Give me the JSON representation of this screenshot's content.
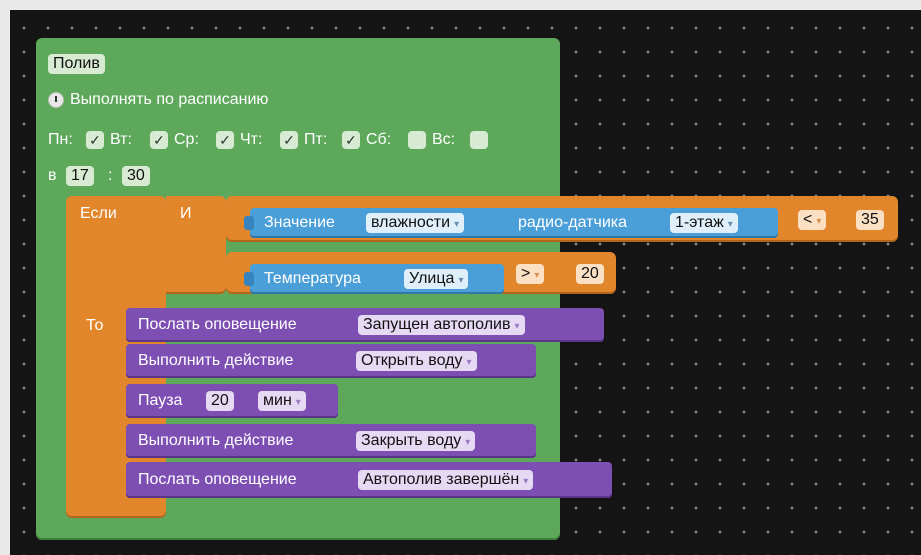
{
  "event_block": {
    "title": "Полив",
    "schedule_label": "Выполнять по расписанию",
    "clock_icon": "clock-icon",
    "days": [
      {
        "label": "Пн:",
        "checked": true
      },
      {
        "label": "Вт:",
        "checked": true
      },
      {
        "label": "Ср:",
        "checked": true
      },
      {
        "label": "Чт:",
        "checked": true
      },
      {
        "label": "Пт:",
        "checked": true
      },
      {
        "label": "Сб:",
        "checked": false
      },
      {
        "label": "Вс:",
        "checked": false
      }
    ],
    "time_prefix": "в",
    "hour": "17",
    "time_sep": ":",
    "minute": "30"
  },
  "if_block": {
    "if_label": "Если",
    "and_label": "И",
    "then_label": "То",
    "condition1": {
      "value_label": "Значение",
      "measure": "влажности",
      "sensor_label": "радио-датчика",
      "sensor": "1-этаж",
      "operator": "<",
      "threshold": "35"
    },
    "condition2": {
      "label": "Температура",
      "location": "Улица",
      "operator": ">",
      "threshold": "20"
    }
  },
  "actions": [
    {
      "label": "Послать оповещение",
      "value": "Запущен автополив"
    },
    {
      "label": "Выполнить действие",
      "value": "Открыть воду"
    },
    {
      "label": "Пауза",
      "amount": "20",
      "unit": "мин"
    },
    {
      "label": "Выполнить действие",
      "value": "Закрыть воду"
    },
    {
      "label": "Послать оповещение",
      "value": "Автополив завершён"
    }
  ],
  "dropdown_glyph": "▾",
  "check_glyph": "✓",
  "colors": {
    "event": "#5ea85c",
    "logic": "#e2862b",
    "sensor": "#4a9fd8",
    "action": "#7e4fb3",
    "workspace": "#141414"
  }
}
